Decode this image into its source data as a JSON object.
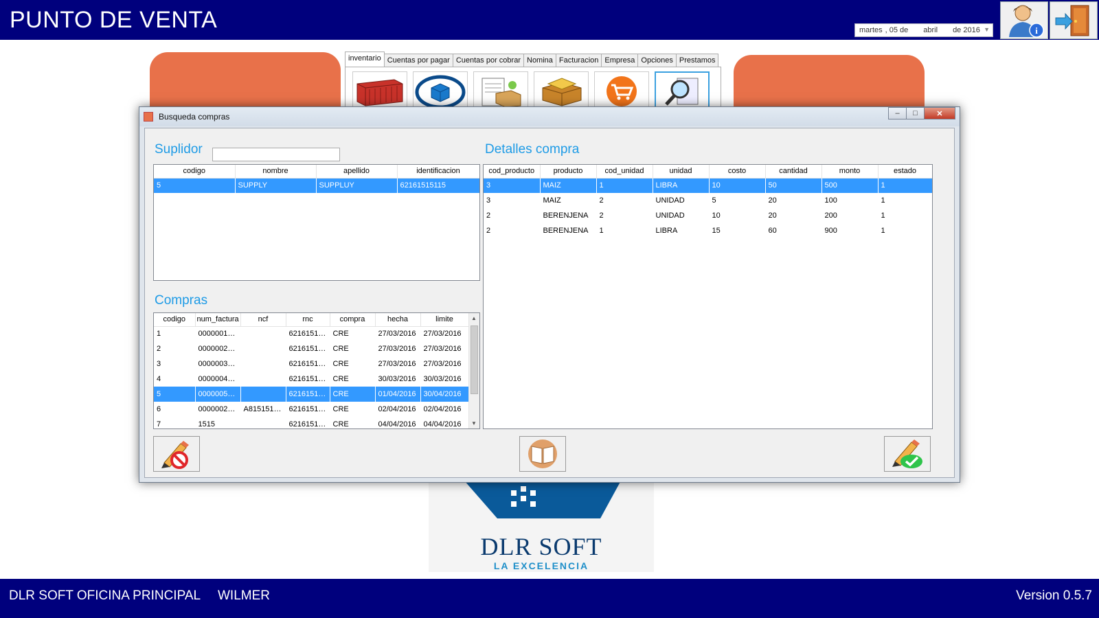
{
  "app": {
    "title": "PUNTO DE VENTA"
  },
  "date_picker": {
    "weekday": "martes",
    "day": ", 05 de",
    "month": "abril",
    "year": "de 2016"
  },
  "tabs": [
    {
      "label": "inventario",
      "active": true
    },
    {
      "label": "Cuentas por pagar",
      "active": false
    },
    {
      "label": "Cuentas por cobrar",
      "active": false
    },
    {
      "label": "Nomina",
      "active": false
    },
    {
      "label": "Facturacion",
      "active": false
    },
    {
      "label": "Empresa",
      "active": false
    },
    {
      "label": "Opciones",
      "active": false
    },
    {
      "label": "Prestamos",
      "active": false
    }
  ],
  "dialog": {
    "title": "Busqueda compras",
    "window_buttons": {
      "minimize": "‒",
      "maximize": "□",
      "close": "✕"
    },
    "suplidor": {
      "label": "Suplidor",
      "search_value": "",
      "columns": [
        "codigo",
        "nombre",
        "apellido",
        "identificacion"
      ],
      "rows": [
        {
          "selected": true,
          "cells": [
            "5",
            "SUPPLY",
            "SUPPLUY",
            "62161515115"
          ]
        }
      ]
    },
    "compras": {
      "label": "Compras",
      "columns": [
        "codigo",
        "num_factura",
        "ncf",
        "rnc",
        "compra",
        "hecha",
        "limite"
      ],
      "rows": [
        {
          "selected": false,
          "cells": [
            "1",
            "00000010...",
            "",
            "62161515...",
            "CRE",
            "27/03/2016",
            "27/03/2016"
          ]
        },
        {
          "selected": false,
          "cells": [
            "2",
            "00000020...",
            "",
            "62161515...",
            "CRE",
            "27/03/2016",
            "27/03/2016"
          ]
        },
        {
          "selected": false,
          "cells": [
            "3",
            "00000030...",
            "",
            "62161515...",
            "CRE",
            "27/03/2016",
            "27/03/2016"
          ]
        },
        {
          "selected": false,
          "cells": [
            "4",
            "00000040...",
            "",
            "62161515...",
            "CRE",
            "30/03/2016",
            "30/03/2016"
          ]
        },
        {
          "selected": true,
          "cells": [
            "5",
            "00000050...",
            "",
            "62161515...",
            "CRE",
            "01/04/2016",
            "30/04/2016"
          ]
        },
        {
          "selected": false,
          "cells": [
            "6",
            "00000020...",
            "A8151518...",
            "62161515...",
            "CRE",
            "02/04/2016",
            "02/04/2016"
          ]
        },
        {
          "selected": false,
          "cells": [
            "7",
            "1515",
            "",
            "62161515...",
            "CRE",
            "04/04/2016",
            "04/04/2016"
          ]
        }
      ]
    },
    "detalles": {
      "label": "Detalles compra",
      "columns": [
        "cod_producto",
        "producto",
        "cod_unidad",
        "unidad",
        "costo",
        "cantidad",
        "monto",
        "estado"
      ],
      "rows": [
        {
          "selected": true,
          "cells": [
            "3",
            "MAIZ",
            "1",
            "LIBRA",
            "10",
            "50",
            "500",
            "1"
          ]
        },
        {
          "selected": false,
          "cells": [
            "3",
            "MAIZ",
            "2",
            "UNIDAD",
            "5",
            "20",
            "100",
            "1"
          ]
        },
        {
          "selected": false,
          "cells": [
            "2",
            "BERENJENA",
            "2",
            "UNIDAD",
            "10",
            "20",
            "200",
            "1"
          ]
        },
        {
          "selected": false,
          "cells": [
            "2",
            "BERENJENA",
            "1",
            "LIBRA",
            "15",
            "60",
            "900",
            "1"
          ]
        }
      ]
    }
  },
  "logo": {
    "name": "DLR SOFT",
    "tagline": "LA EXCELENCIA"
  },
  "status_bar": {
    "office": "DLR SOFT OFICINA PRINCIPAL",
    "user": "WILMER",
    "version": "Version 0.5.7"
  },
  "colors": {
    "primary": "#00007d",
    "accent": "#e8714a",
    "selection": "#3399ff",
    "section_label": "#1e9be6"
  }
}
